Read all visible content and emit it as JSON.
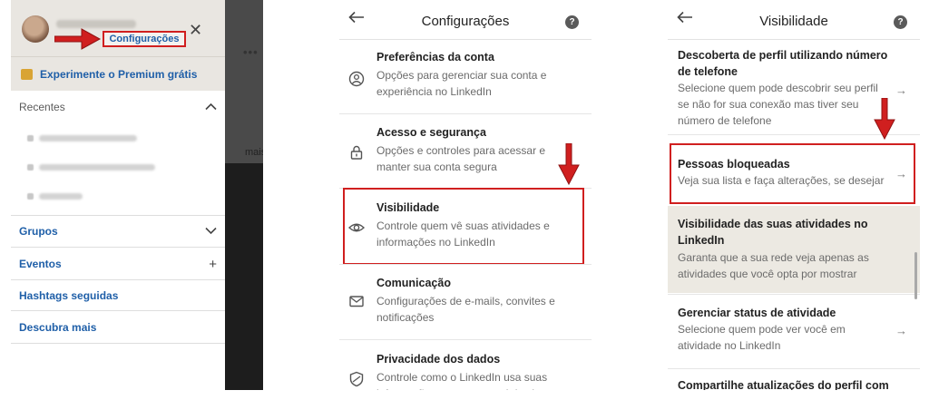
{
  "drawer": {
    "settings_link": "Configurações",
    "premium_label": "Experimente o Premium grátis",
    "recentes_label": "Recentes",
    "groups_label": "Grupos",
    "events_label": "Eventos",
    "hashtags_label": "Hashtags seguidas",
    "discover_label": "Descubra mais",
    "side_text": "mais"
  },
  "settings": {
    "title": "Configurações",
    "options": [
      {
        "title": "Preferências da conta",
        "desc": "Opções para gerenciar sua conta e experiência no LinkedIn",
        "icon": "account-preferences-icon"
      },
      {
        "title": "Acesso e segurança",
        "desc": "Opções e controles para acessar e manter sua conta segura",
        "icon": "lock-icon"
      },
      {
        "title": "Visibilidade",
        "desc": "Controle quem vê suas atividades e informações no LinkedIn",
        "icon": "eye-icon"
      },
      {
        "title": "Comunicação",
        "desc": "Configurações de e-mails, convites e notificações",
        "icon": "envelope-icon"
      },
      {
        "title": "Privacidade dos dados",
        "desc": "Controle como o LinkedIn usa suas informações para uso geral do site e",
        "icon": "shield-icon"
      }
    ]
  },
  "visibility": {
    "title": "Visibilidade",
    "rows": [
      {
        "title": "Descoberta de perfil utilizando número de telefone",
        "desc": "Selecione quem pode descobrir seu perfil se não for sua conexão mas tiver seu número de telefone"
      },
      {
        "title": "Pessoas bloqueadas",
        "desc": "Veja sua lista e faça alterações, se desejar"
      },
      {
        "title": "Visibilidade das suas atividades no LinkedIn",
        "desc": "Garanta que a sua rede veja apenas as atividades que você opta por mostrar"
      },
      {
        "title": "Gerenciar status de atividade",
        "desc": "Selecione quem pode ver você em atividade no LinkedIn"
      },
      {
        "title": "Compartilhe atualizações do perfil com"
      }
    ]
  },
  "colors": {
    "accent_red": "#d01f1f",
    "link_blue": "#1f5fa8",
    "highlight": "#ece9e2"
  }
}
